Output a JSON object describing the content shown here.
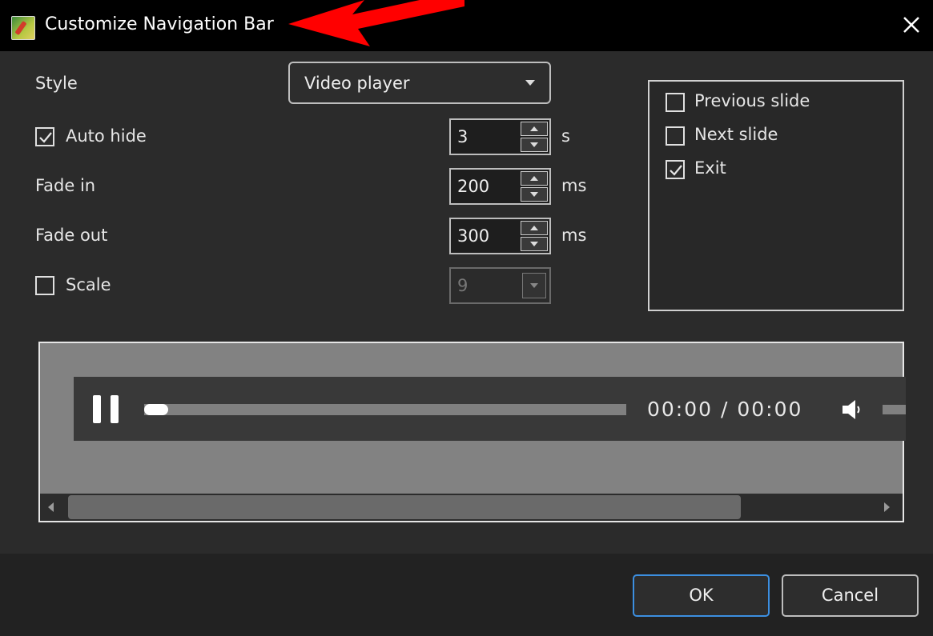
{
  "window": {
    "title": "Customize Navigation Bar",
    "close_icon": "close-icon",
    "app_icon": "app-icon"
  },
  "style": {
    "label": "Style",
    "selected": "Video player"
  },
  "auto_hide": {
    "label": "Auto hide",
    "checked": true,
    "value": "3",
    "unit": "s"
  },
  "fade_in": {
    "label": "Fade in",
    "value": "200",
    "unit": "ms"
  },
  "fade_out": {
    "label": "Fade out",
    "value": "300",
    "unit": "ms"
  },
  "scale": {
    "label": "Scale",
    "checked": false,
    "value": "9"
  },
  "nav_buttons": [
    {
      "label": "Previous slide",
      "checked": false
    },
    {
      "label": "Next slide",
      "checked": false
    },
    {
      "label": "Exit",
      "checked": true
    }
  ],
  "preview": {
    "time": "00:00 / 00:00",
    "progress_fraction": 0.05
  },
  "footer": {
    "ok_label": "OK",
    "cancel_label": "Cancel"
  },
  "colors": {
    "accent": "#3c8fe0",
    "annotation_arrow": "#ff0000"
  }
}
